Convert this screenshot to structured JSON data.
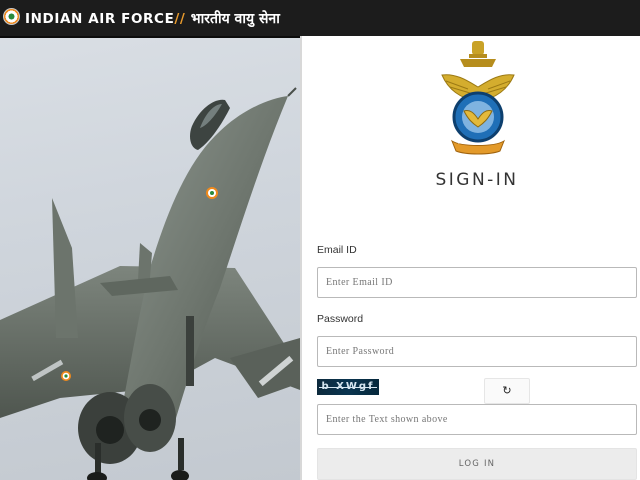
{
  "header": {
    "brand_en": "INDIAN AIR FORCE",
    "separator": "//",
    "brand_hi": "भारतीय वायु सेना",
    "logo_icon": "iaf-roundel-icon"
  },
  "hero": {
    "image": "fighter-jet-photo"
  },
  "signin": {
    "emblem": "iaf-crest-emblem",
    "title": "SIGN-IN",
    "email_label": "Email ID",
    "email_placeholder": "Enter Email ID",
    "password_label": "Password",
    "password_placeholder": "Enter Password",
    "captcha_text": "b XWgf",
    "refresh_icon": "↻",
    "captcha_placeholder": "Enter the Text shown above",
    "login_label": "LOG IN"
  }
}
